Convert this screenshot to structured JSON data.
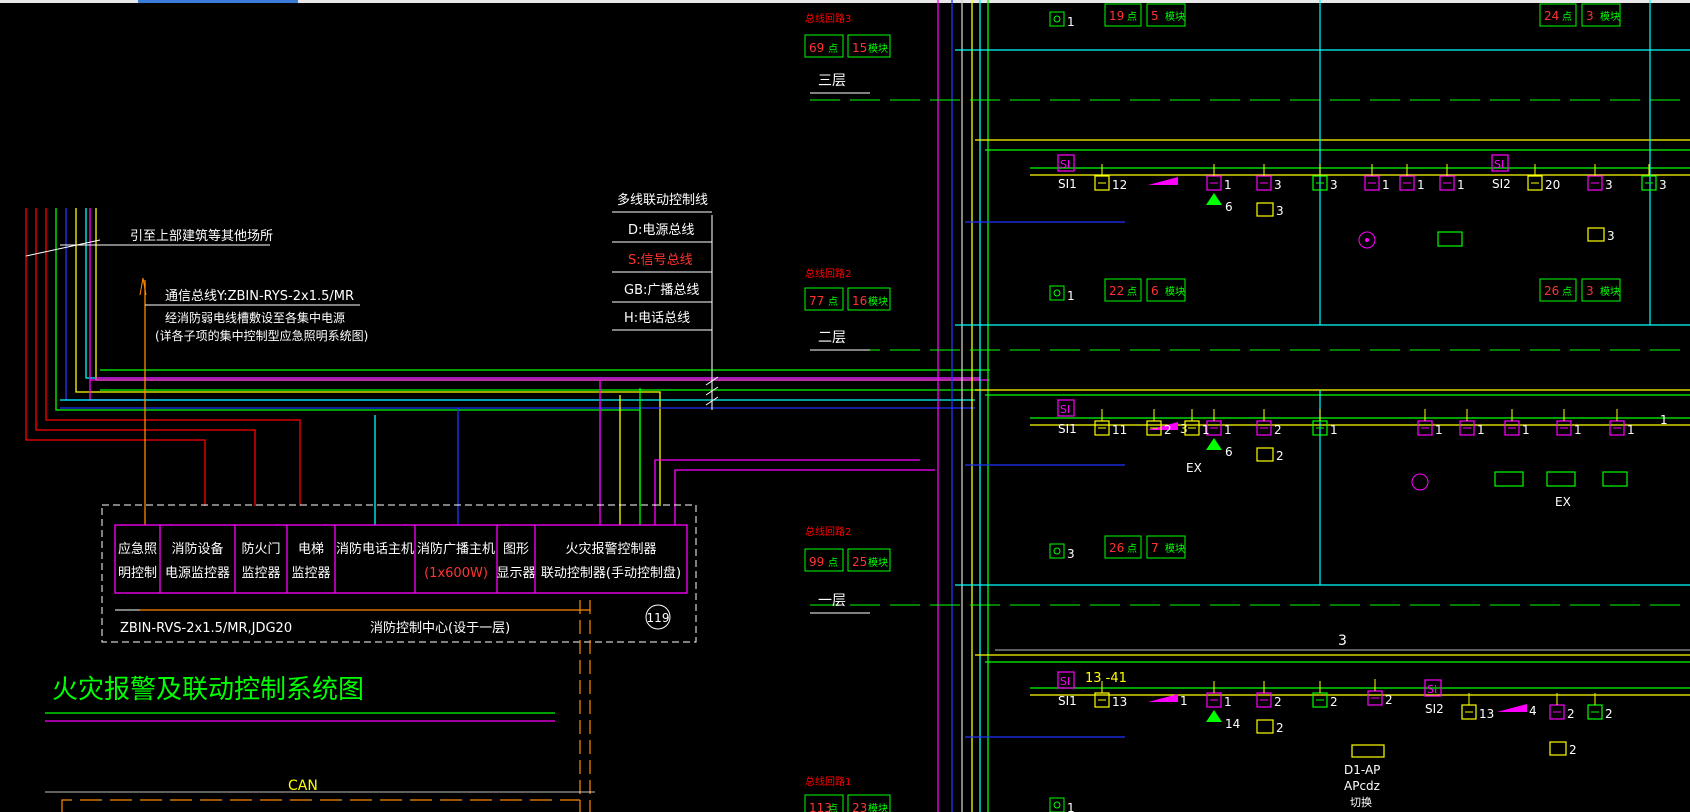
{
  "colors": {
    "background": "#000000",
    "green": "#00ff00",
    "yellow": "#ffff00",
    "magenta": "#ff00ff",
    "cyan": "#00ffff",
    "red": "#ff0000",
    "blue": "#2233ff",
    "white": "#ffffff",
    "orange": "#ff8800"
  },
  "title": "火灾报警及联动控制系统图",
  "left": {
    "lead_up_label": "引至上部建筑等其他场所",
    "comm_bus": "通信总线Y:ZBIN-RYS-2x1.5/MR",
    "comm_note1": "经消防弱电线槽敷设至各集中电源",
    "comm_note2": "(详各子项的集中控制型应急照明系统图)",
    "multi_line_header": "多线联动控制线",
    "bus_d": "D:电源总线",
    "bus_s": "S:信号总线",
    "bus_gb": "GB:广播总线",
    "bus_h": "H:电话总线",
    "cable_label": "ZBIN-RVS-2x1.5/MR,JDG20",
    "center_label": "消防控制中心(设于一层)",
    "number_badge": "119",
    "can_label": "CAN"
  },
  "panel": [
    {
      "l1": "应急照",
      "l2": "明控制"
    },
    {
      "l1": "消防设备",
      "l2": "电源监控器"
    },
    {
      "l1": "防火门",
      "l2": "监控器"
    },
    {
      "l1": "电梯",
      "l2": "监控器"
    },
    {
      "l1": "消防电话主机",
      "l2": ""
    },
    {
      "l1": "消防广播主机",
      "l2": "(1x600W)"
    },
    {
      "l1": "图形",
      "l2": "显示器"
    },
    {
      "l1": "火灾报警控制器",
      "l2": "联动控制器(手动控制盘)"
    }
  ],
  "floors": {
    "f3": {
      "loop": "总线回路3",
      "points": "69",
      "dian": "点",
      "modules": "15",
      "mod_unit": "模块",
      "name": "三层"
    },
    "f2": {
      "loop": "总线回路2",
      "points": "77",
      "dian": "点",
      "modules": "16",
      "mod_unit": "模块",
      "name": "二层"
    },
    "f1": {
      "loop": "总线回路2",
      "points": "99",
      "dian": "点",
      "modules": "25",
      "mod_unit": "模块",
      "name": "一层"
    },
    "fb": {
      "loop": "总线回路1",
      "points": "113",
      "dian": "点",
      "modules": "23",
      "mod_unit": "模块"
    }
  },
  "right": {
    "top_a_pts": "19",
    "top_a_mod": "5",
    "top_b_pts": "24",
    "top_b_mod": "3",
    "mid_a_pts": "22",
    "mid_a_mod": "6",
    "mid_b_pts": "26",
    "mid_b_mod": "3",
    "low_a_pts": "26",
    "low_a_mod": "7",
    "si1": "SI1",
    "si2": "SI2",
    "row1": {
      "c12": "12",
      "c1a": "1",
      "c6": "6",
      "c1b": "1",
      "c3": "3",
      "c3b": "3",
      "c3c": "3",
      "c1c": "1",
      "c1d": "1",
      "c1e": "1",
      "c20": "20",
      "c3d": "3",
      "c3e": "3",
      "c3f": "3"
    },
    "row2": {
      "c11": "11",
      "c2": "2",
      "c1": "1",
      "c3": "3",
      "c1b": "1",
      "c6": "6",
      "c2b": "2",
      "c2c": "2",
      "c1c": "1",
      "c1d": "1",
      "c1e": "1",
      "c1f": "1",
      "c1g": "1",
      "c1h": "1",
      "c1i": "1",
      "ex1": "EX",
      "ex2": "EX"
    },
    "row3": {
      "c13": "13",
      "c1": "1",
      "c14": "14",
      "c2": "2",
      "c2b": "2",
      "c2c": "2",
      "c13b": "13",
      "c4": "4",
      "c2d": "2",
      "c2e": "2",
      "c2f": "2",
      "tag": "13 -41",
      "d1": "D1-AP",
      "d2": "APcdz",
      "d3": "切换"
    },
    "ring1": "1",
    "ring2": "1",
    "ring3": "3",
    "ring4": "1",
    "mark3": "3"
  }
}
